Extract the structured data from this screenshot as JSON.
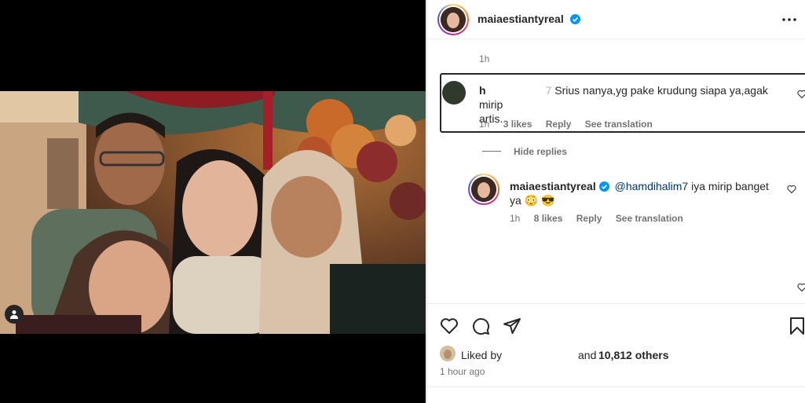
{
  "post": {
    "author": "maiaestiantyreal",
    "verified": true
  },
  "comments": {
    "prev_time": "1h",
    "highlighted": {
      "username_fragment": "h",
      "username_suffix": "7",
      "text_line1": "Srius nanya,yg pake krudung siapa ya,agak mirip",
      "text_line2": "artis.",
      "time": "1h",
      "likes": "3 likes",
      "reply": "Reply",
      "translate": "See translation"
    },
    "hide_replies": "Hide replies",
    "reply_item": {
      "username": "maiaestiantyreal",
      "mention": "@hamdihalim7",
      "text_line1": " iya mirip banget",
      "text_line2": "ya 😳 😎",
      "time": "1h",
      "likes": "8 likes",
      "reply": "Reply",
      "translate": "See translation"
    }
  },
  "actions": {
    "icons": [
      "heart-icon",
      "comment-icon",
      "share-icon",
      "bookmark-icon"
    ]
  },
  "likes": {
    "prefix": "Liked by",
    "and": "and",
    "count": "10,812 others"
  },
  "timestamp": "1 hour ago",
  "colors": {
    "link": "#00376b",
    "verified": "#0095f6",
    "muted": "#737373",
    "text": "#262626"
  }
}
